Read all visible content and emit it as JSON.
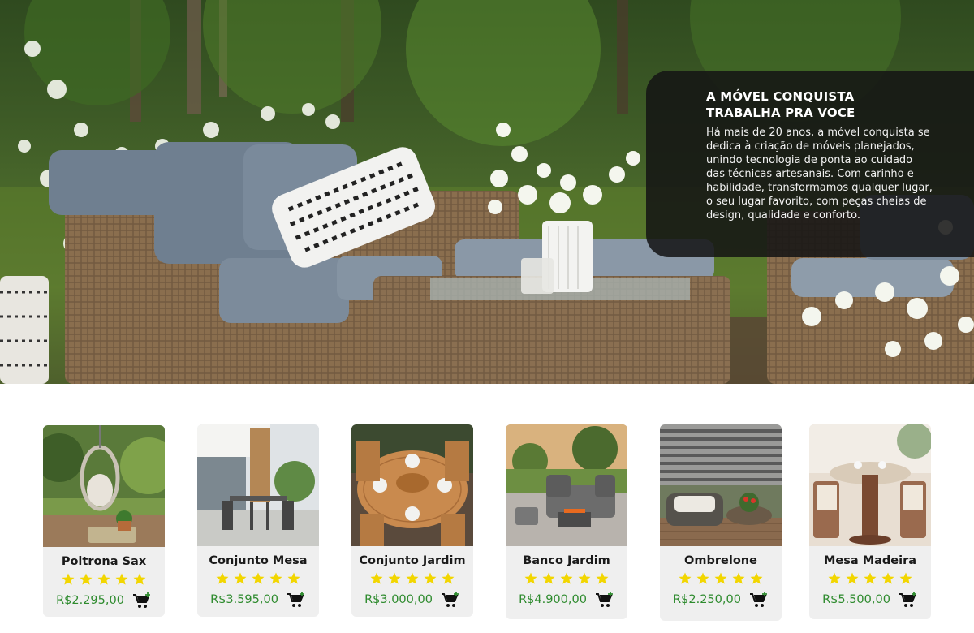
{
  "hero": {
    "title": "A MÓVEL CONQUISTA TRABALHA PRA VOCE",
    "text": "Há mais de 20 anos, a móvel conquista se dedica à criação de móveis planejados, unindo tecnologia de ponta ao cuidado das técnicas artesanais. Com carinho e habilidade, transformamos qualquer lugar, o seu lugar favorito, com peças cheias de design, qualidade e conforto."
  },
  "products": [
    {
      "name": "Poltrona Sax",
      "price": "R$2.295,00",
      "rating": 5,
      "icon": "cart-add-icon"
    },
    {
      "name": "Conjunto Mesa",
      "price": "R$3.595,00",
      "rating": 5,
      "icon": "cart-add-icon"
    },
    {
      "name": "Conjunto Jardim",
      "price": "R$3.000,00",
      "rating": 5,
      "icon": "cart-add-icon"
    },
    {
      "name": "Banco Jardim",
      "price": "R$4.900,00",
      "rating": 5,
      "icon": "cart-add-icon"
    },
    {
      "name": "Ombrelone",
      "price": "R$2.250,00",
      "rating": 5,
      "icon": "cart-add-icon"
    },
    {
      "name": "Mesa Madeira",
      "price": "R$5.500,00",
      "rating": 5,
      "icon": "cart-add-icon"
    }
  ],
  "colors": {
    "price": "#2e8b2e",
    "star": "#f2d600",
    "card_bg": "#efefef",
    "hero_panel": "#141414"
  }
}
